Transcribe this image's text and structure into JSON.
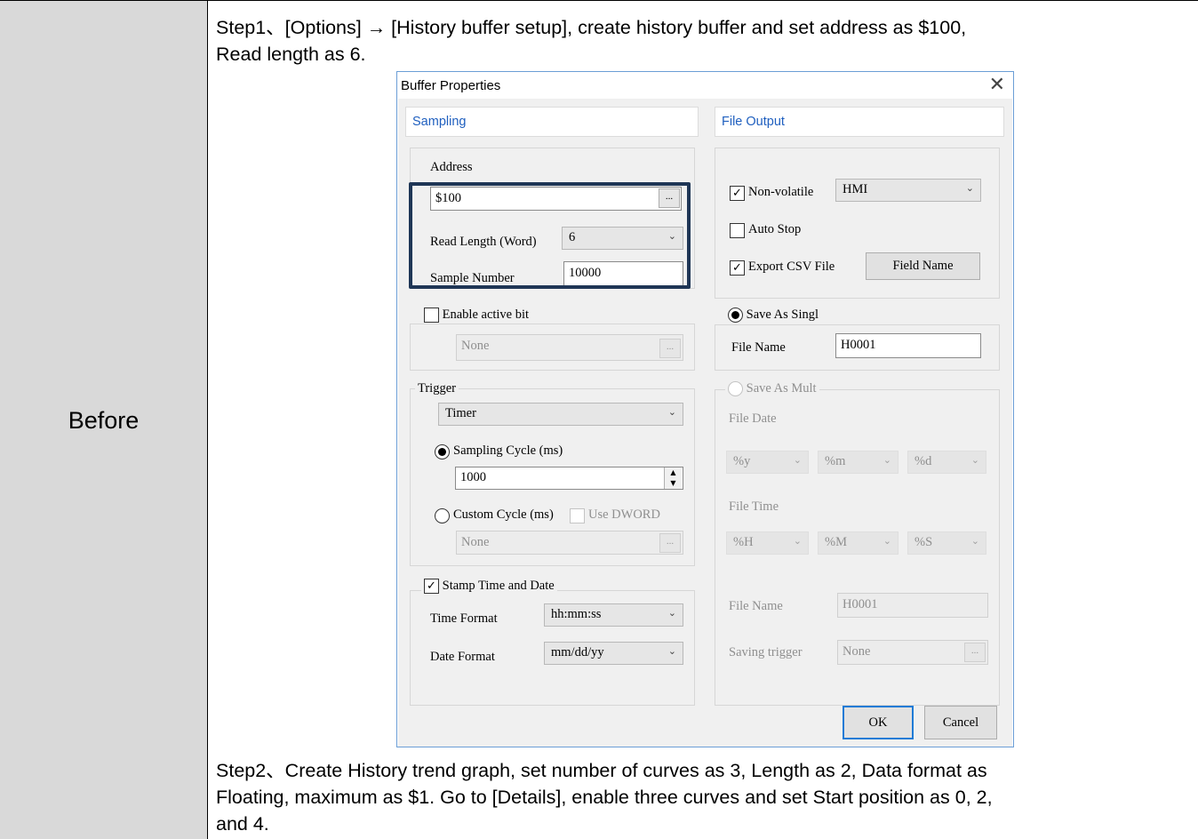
{
  "row_label": "Before",
  "step1": "Step1、[Options] → [History buffer setup], create history buffer and set address as $100,\nRead length as 6.",
  "step2": "Step2、Create History trend graph, set number of curves as 3, Length as 2, Data format as\nFloating, maximum as $1. Go to [Details], enable three curves and set Start position as 0, 2,\nand 4.",
  "dialog": {
    "title": "Buffer Properties",
    "close_glyph": "✕",
    "sampling": {
      "header": "Sampling",
      "address_label": "Address",
      "address_value": "$100",
      "browse_glyph": "...",
      "read_length_label": "Read Length (Word)",
      "read_length_value": "6",
      "sample_number_label": "Sample Number",
      "sample_number_value": "10000",
      "enable_active_bit_label": "Enable active bit",
      "enable_active_bit_checked": false,
      "active_bit_value": "None",
      "trigger_label": "Trigger",
      "trigger_value": "Timer",
      "sampling_cycle_label": "Sampling Cycle (ms)",
      "sampling_cycle_value": "1000",
      "custom_cycle_label": "Custom Cycle (ms)",
      "use_dword_label": "Use DWORD",
      "custom_cycle_value": "None",
      "stamp_label": "Stamp Time and Date",
      "stamp_checked": true,
      "time_format_label": "Time Format",
      "time_format_value": "hh:mm:ss",
      "date_format_label": "Date Format",
      "date_format_value": "mm/dd/yy"
    },
    "file_output": {
      "header": "File Output",
      "non_volatile_label": "Non-volatile",
      "non_volatile_checked": true,
      "non_volatile_value": "HMI",
      "auto_stop_label": "Auto Stop",
      "auto_stop_checked": false,
      "export_csv_label": "Export CSV File",
      "export_csv_checked": true,
      "field_name_button": "Field Name",
      "save_single_label": "Save As Singl",
      "file_name_label": "File Name",
      "file_name_value": "H0001",
      "save_multi_label": "Save As Mult",
      "file_date_label": "File Date",
      "date_y": "%y",
      "date_m": "%m",
      "date_d": "%d",
      "file_time_label": "File Time",
      "time_h": "%H",
      "time_m": "%M",
      "time_s": "%S",
      "multi_file_name_label": "File Name",
      "multi_file_name_value": "H0001",
      "saving_trigger_label": "Saving trigger",
      "saving_trigger_value": "None"
    },
    "ok_button": "OK",
    "cancel_button": "Cancel"
  },
  "colors": {
    "left_cell": "#d9d9d9",
    "header_text": "#1f5fbf",
    "highlight_box": "#1f3656",
    "dialog_border": "#6b9ed6"
  }
}
